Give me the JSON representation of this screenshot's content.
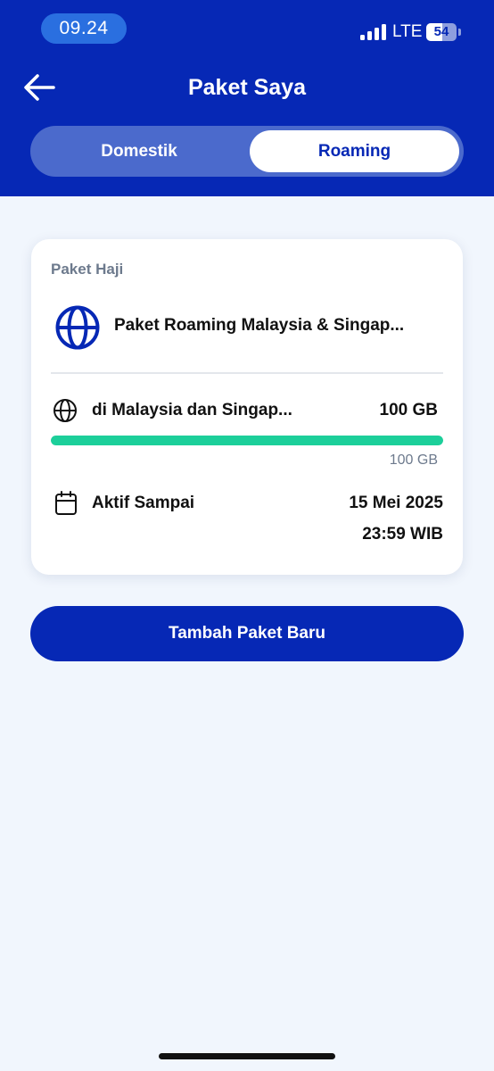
{
  "status_bar": {
    "time": "09.24",
    "network": "LTE",
    "battery_level": "54"
  },
  "header": {
    "title": "Paket Saya",
    "back_icon": "arrow-left-icon"
  },
  "tabs": [
    {
      "label": "Domestik",
      "active": false
    },
    {
      "label": "Roaming",
      "active": true
    }
  ],
  "package_card": {
    "category": "Paket Haji",
    "icon": "globe-icon",
    "name": "Paket Roaming Malaysia & Singap...",
    "quota": {
      "location": "di Malaysia dan Singap...",
      "remaining": "100 GB",
      "total": "100 GB",
      "fraction_remaining": 1.0
    },
    "active_until": {
      "label": "Aktif Sampai",
      "date": "15 Mei 2025",
      "time": "23:59 WIB"
    }
  },
  "actions": {
    "add_package": "Tambah Paket Baru"
  },
  "colors": {
    "primary": "#0628b5",
    "progress": "#1ccf9a",
    "background": "#f1f6fd"
  }
}
